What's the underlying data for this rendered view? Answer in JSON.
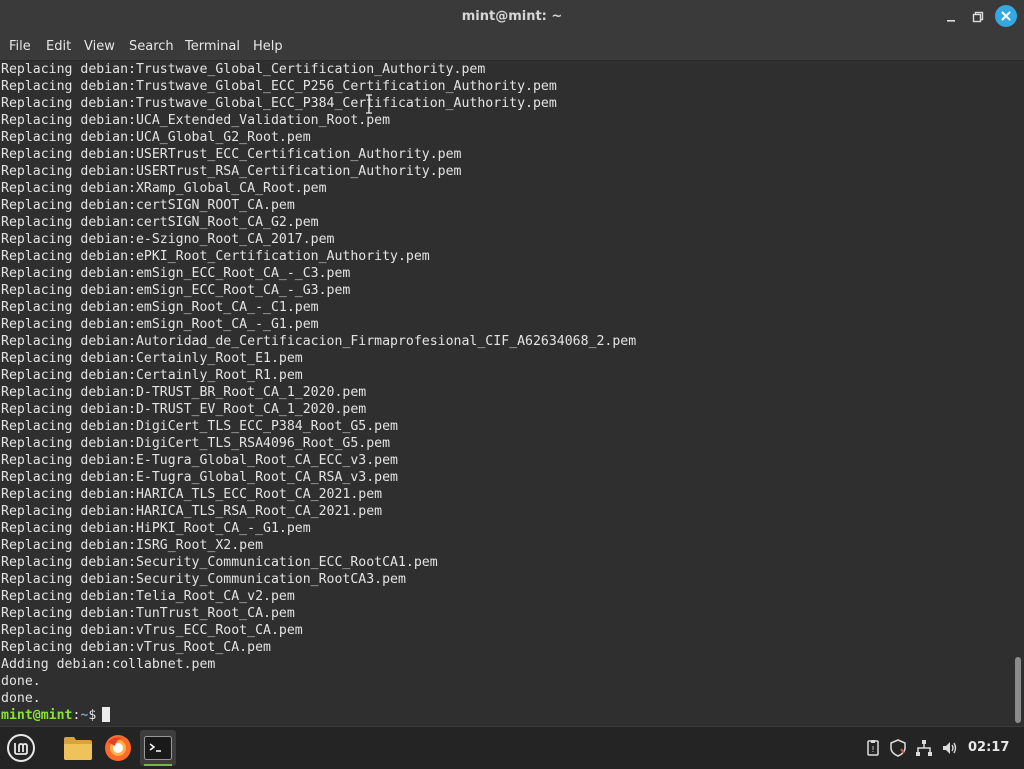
{
  "window": {
    "title": "mint@mint: ~"
  },
  "menu": {
    "items": [
      {
        "label": "File"
      },
      {
        "label": "Edit"
      },
      {
        "label": "View"
      },
      {
        "label": "Search"
      },
      {
        "label": "Terminal"
      },
      {
        "label": "Help"
      }
    ]
  },
  "terminal": {
    "lines": [
      "Replacing debian:Trustwave_Global_Certification_Authority.pem",
      "Replacing debian:Trustwave_Global_ECC_P256_Certification_Authority.pem",
      "Replacing debian:Trustwave_Global_ECC_P384_Certification_Authority.pem",
      "Replacing debian:UCA_Extended_Validation_Root.pem",
      "Replacing debian:UCA_Global_G2_Root.pem",
      "Replacing debian:USERTrust_ECC_Certification_Authority.pem",
      "Replacing debian:USERTrust_RSA_Certification_Authority.pem",
      "Replacing debian:XRamp_Global_CA_Root.pem",
      "Replacing debian:certSIGN_ROOT_CA.pem",
      "Replacing debian:certSIGN_Root_CA_G2.pem",
      "Replacing debian:e-Szigno_Root_CA_2017.pem",
      "Replacing debian:ePKI_Root_Certification_Authority.pem",
      "Replacing debian:emSign_ECC_Root_CA_-_C3.pem",
      "Replacing debian:emSign_ECC_Root_CA_-_G3.pem",
      "Replacing debian:emSign_Root_CA_-_C1.pem",
      "Replacing debian:emSign_Root_CA_-_G1.pem",
      "Replacing debian:Autoridad_de_Certificacion_Firmaprofesional_CIF_A62634068_2.pem",
      "Replacing debian:Certainly_Root_E1.pem",
      "Replacing debian:Certainly_Root_R1.pem",
      "Replacing debian:D-TRUST_BR_Root_CA_1_2020.pem",
      "Replacing debian:D-TRUST_EV_Root_CA_1_2020.pem",
      "Replacing debian:DigiCert_TLS_ECC_P384_Root_G5.pem",
      "Replacing debian:DigiCert_TLS_RSA4096_Root_G5.pem",
      "Replacing debian:E-Tugra_Global_Root_CA_ECC_v3.pem",
      "Replacing debian:E-Tugra_Global_Root_CA_RSA_v3.pem",
      "Replacing debian:HARICA_TLS_ECC_Root_CA_2021.pem",
      "Replacing debian:HARICA_TLS_RSA_Root_CA_2021.pem",
      "Replacing debian:HiPKI_Root_CA_-_G1.pem",
      "Replacing debian:ISRG_Root_X2.pem",
      "Replacing debian:Security_Communication_ECC_RootCA1.pem",
      "Replacing debian:Security_Communication_RootCA3.pem",
      "Replacing debian:Telia_Root_CA_v2.pem",
      "Replacing debian:TunTrust_Root_CA.pem",
      "Replacing debian:vTrus_ECC_Root_CA.pem",
      "Replacing debian:vTrus_Root_CA.pem",
      "Adding debian:collabnet.pem",
      "done.",
      "done."
    ],
    "prompt": {
      "user_host": "mint@mint",
      "separator": ":",
      "path": "~",
      "symbol": "$"
    },
    "scroll_position": 0.95
  },
  "taskbar": {
    "apps": [
      {
        "name": "menu-icon"
      },
      {
        "name": "files-icon"
      },
      {
        "name": "firefox-icon"
      },
      {
        "name": "terminal-icon"
      }
    ],
    "clock": "02:17"
  },
  "colors": {
    "prompt_user": "#8ae234",
    "prompt_path": "#729fcf",
    "close_button": "#35a8e0",
    "mint_green": "#7cb342"
  }
}
